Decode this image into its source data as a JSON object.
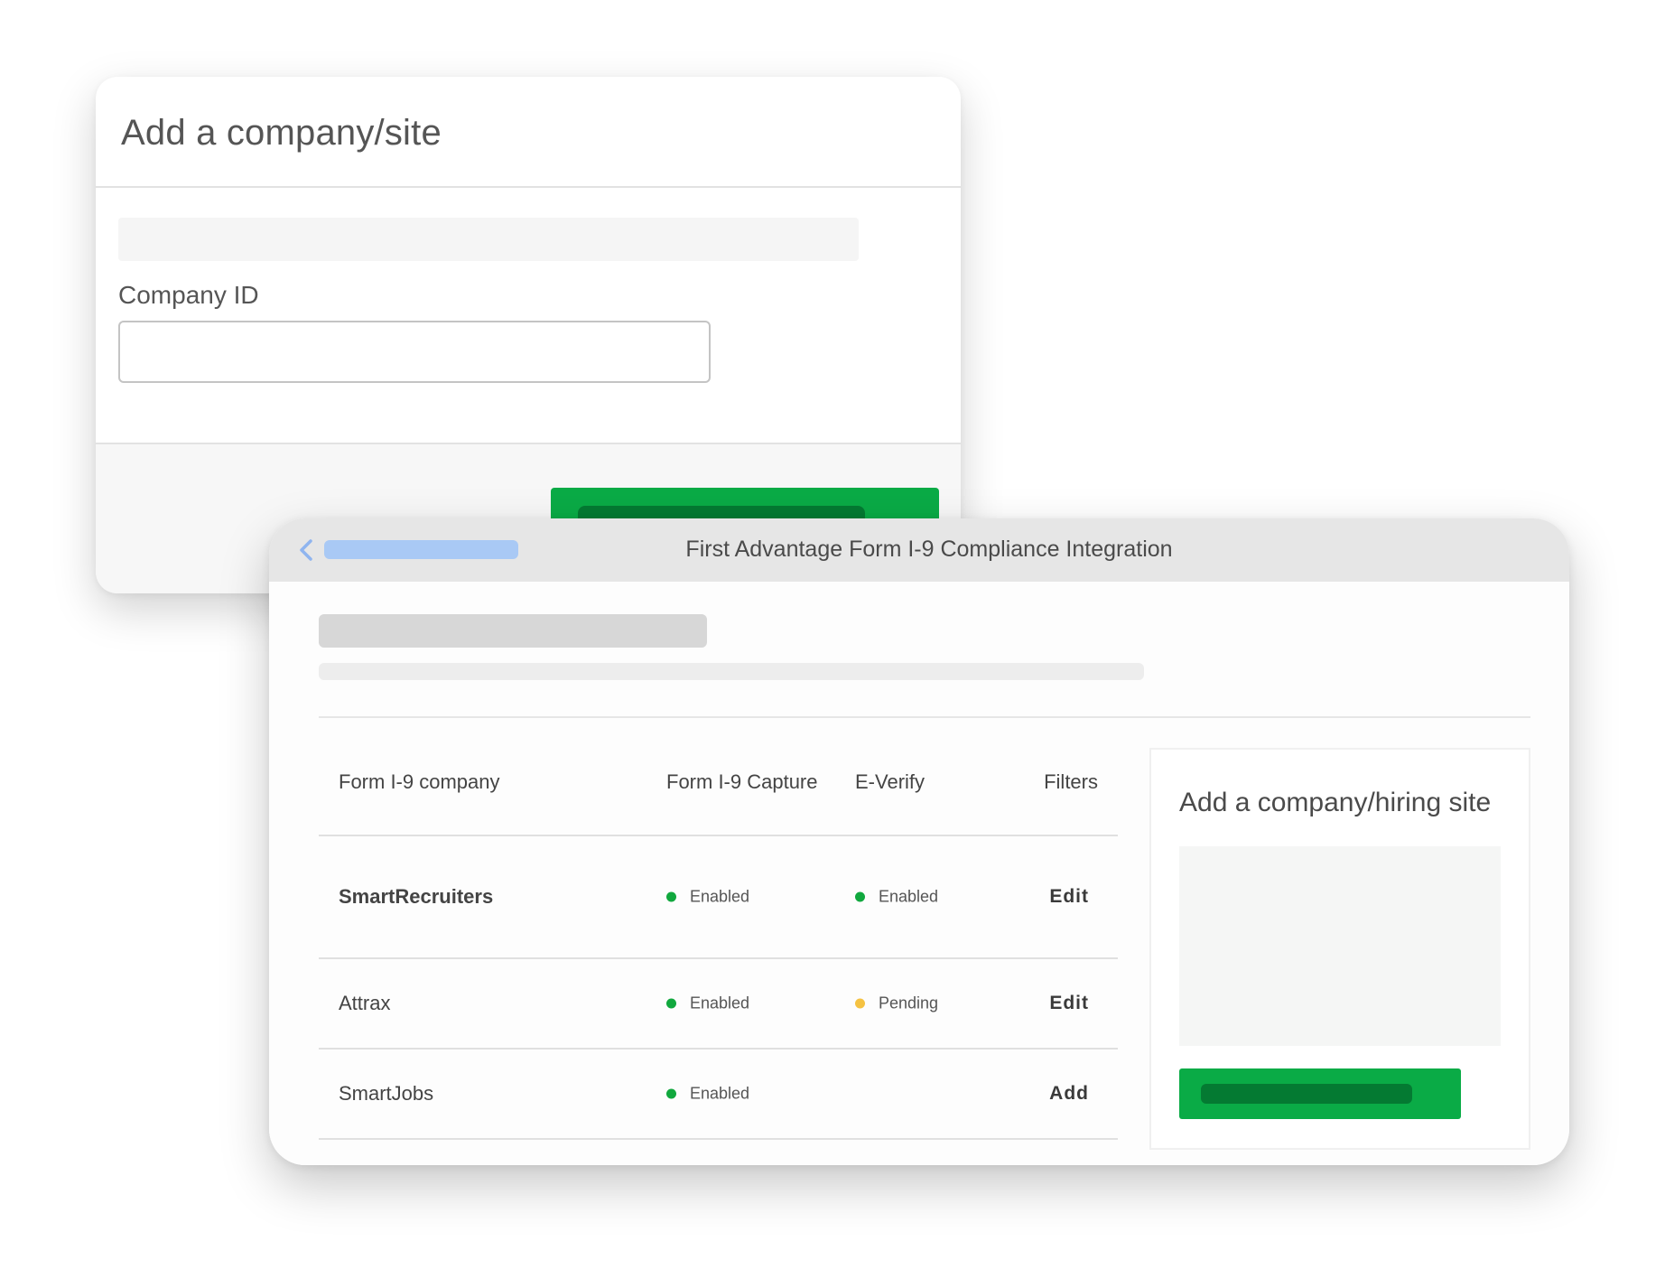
{
  "back_modal": {
    "title": "Add a company/site",
    "company_id_label": "Company ID",
    "company_id_value": "",
    "submit_color": "#0aab46"
  },
  "integration": {
    "title": "First Advantage Form I-9 Compliance Integration",
    "table": {
      "headers": [
        "Form I-9 company",
        "Form I-9 Capture",
        "E-Verify",
        "Filters"
      ],
      "rows": [
        {
          "company": "SmartRecruiters",
          "capture": "Enabled",
          "everify": "Enabled",
          "action": "Edit"
        },
        {
          "company": "Attrax",
          "capture": "Enabled",
          "everify": "Pending",
          "action": "Edit"
        },
        {
          "company": "SmartJobs",
          "capture": "Enabled",
          "everify": "",
          "action": "Add"
        }
      ]
    },
    "side_panel": {
      "title": "Add a company/hiring site"
    }
  },
  "colors": {
    "enabled": "#11a83e",
    "pending": "#f5c242",
    "accent_green": "#0aab46",
    "accent_green_dark": "#047a32",
    "breadcrumb_blue": "#a9c9f5"
  }
}
